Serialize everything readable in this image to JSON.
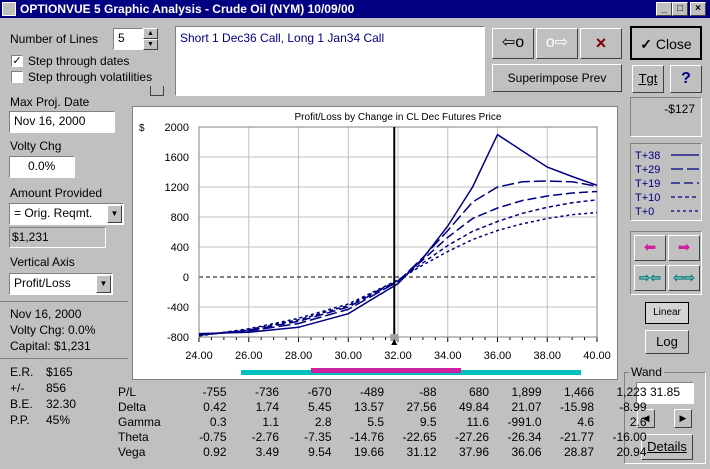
{
  "window": {
    "title": "OPTIONVUE 5 Graphic Analysis - Crude Oil (NYM)  10/09/00",
    "min": "_",
    "max": "□",
    "close": "×"
  },
  "left": {
    "number_of_lines_label": "Number of Lines",
    "number_of_lines_value": "5",
    "step_dates_label": "Step through dates",
    "step_dates_checked": true,
    "step_vols_label": "Step through volatilities",
    "step_vols_checked": false,
    "max_proj_date_label": "Max Proj. Date",
    "max_proj_date_value": "Nov 16, 2000",
    "volty_chg_label": "Volty Chg",
    "volty_chg_value": "0.0%",
    "amount_provided_label": "Amount Provided",
    "amount_provided_value": "= Orig. Reqmt.",
    "amount_value": "$1,231",
    "vertical_axis_label": "Vertical Axis",
    "vertical_axis_value": "Profit/Loss",
    "summary_date": "Nov 16, 2000",
    "summary_volty": "Volty Chg:  0.0%",
    "summary_capital": "Capital:  $1,231",
    "stats": [
      {
        "k": "E.R.",
        "v": "$165"
      },
      {
        "k": "+/-",
        "v": "856"
      },
      {
        "k": "B.E.",
        "v": "32.30"
      },
      {
        "k": "P.P.",
        "v": "45%"
      }
    ]
  },
  "position_text": "Short 1 Dec36 Call, Long 1 Jan34 Call",
  "buttons": {
    "close": "Close",
    "superimpose": "Superimpose Prev",
    "tgt": "Tgt",
    "help": "?",
    "linear": "Linear",
    "log": "Log",
    "details": "Details"
  },
  "readout": "-$127",
  "legend": [
    {
      "label": "T+38",
      "dash": ""
    },
    {
      "label": "T+29",
      "dash": "12 4"
    },
    {
      "label": "T+19",
      "dash": "9 4"
    },
    {
      "label": "T+10",
      "dash": "4 3"
    },
    {
      "label": "T+0",
      "dash": "3 3"
    }
  ],
  "wand": {
    "label": "Wand",
    "value": "31.85"
  },
  "colors": {
    "line": "#000080",
    "pink": "#d020a0",
    "cyan": "#00c0c0",
    "window_bg": "#c0c0c0",
    "title_bg": "#000080"
  },
  "chart_data": {
    "type": "line",
    "title": "Profit/Loss by Change in CL Dec Futures Price",
    "ylabel": "$",
    "xlim": [
      24,
      40
    ],
    "ylim": [
      -800,
      2000
    ],
    "x_ticks": [
      "24.00",
      "26.00",
      "28.00",
      "30.00",
      "32.00",
      "34.00",
      "36.00",
      "38.00",
      "40.00"
    ],
    "y_ticks": [
      "2000",
      "1600",
      "1200",
      "800",
      "400",
      "0",
      "-400",
      "-800"
    ],
    "cursor_x": 31.85,
    "x": [
      24,
      26,
      28,
      30,
      32,
      33,
      34,
      35,
      36,
      37,
      38,
      39,
      40
    ],
    "series": [
      {
        "name": "T+38",
        "values": [
          -755,
          -736,
          -670,
          -489,
          -88,
          250,
          680,
          1200,
          1899,
          1680,
          1466,
          1340,
          1223
        ],
        "dash": ""
      },
      {
        "name": "T+29",
        "values": [
          -770,
          -720,
          -620,
          -430,
          -60,
          260,
          620,
          1000,
          1200,
          1270,
          1280,
          1270,
          1210
        ],
        "dash": "12 4"
      },
      {
        "name": "T+19",
        "values": [
          -775,
          -710,
          -590,
          -400,
          -50,
          230,
          530,
          780,
          920,
          1020,
          1080,
          1120,
          1140
        ],
        "dash": "9 4"
      },
      {
        "name": "T+10",
        "values": [
          -780,
          -700,
          -570,
          -380,
          -45,
          190,
          420,
          610,
          740,
          850,
          930,
          990,
          1030
        ],
        "dash": "4 3"
      },
      {
        "name": "T+0",
        "values": [
          -785,
          -690,
          -550,
          -360,
          -40,
          160,
          340,
          500,
          620,
          710,
          780,
          830,
          860
        ],
        "dash": "3 3"
      }
    ]
  },
  "table": {
    "rows": [
      {
        "label": "P/L",
        "values": [
          "-755",
          "-736",
          "-670",
          "-489",
          "-88",
          "680",
          "1,899",
          "1,466",
          "1,223"
        ]
      },
      {
        "label": "Delta",
        "values": [
          "0.42",
          "1.74",
          "5.45",
          "13.57",
          "27.56",
          "49.84",
          "21.07",
          "-15.98",
          "-8.99"
        ]
      },
      {
        "label": "Gamma",
        "values": [
          "0.3",
          "1.1",
          "2.8",
          "5.5",
          "9.5",
          "11.6",
          "-991.0",
          "4.6",
          "2.6"
        ]
      },
      {
        "label": "Theta",
        "values": [
          "-0.75",
          "-2.76",
          "-7.35",
          "-14.76",
          "-22.65",
          "-27.26",
          "-26.34",
          "-21.77",
          "-16.00"
        ]
      },
      {
        "label": "Vega",
        "values": [
          "0.92",
          "3.49",
          "9.54",
          "19.66",
          "31.12",
          "37.96",
          "36.06",
          "28.87",
          "20.94"
        ]
      }
    ]
  }
}
